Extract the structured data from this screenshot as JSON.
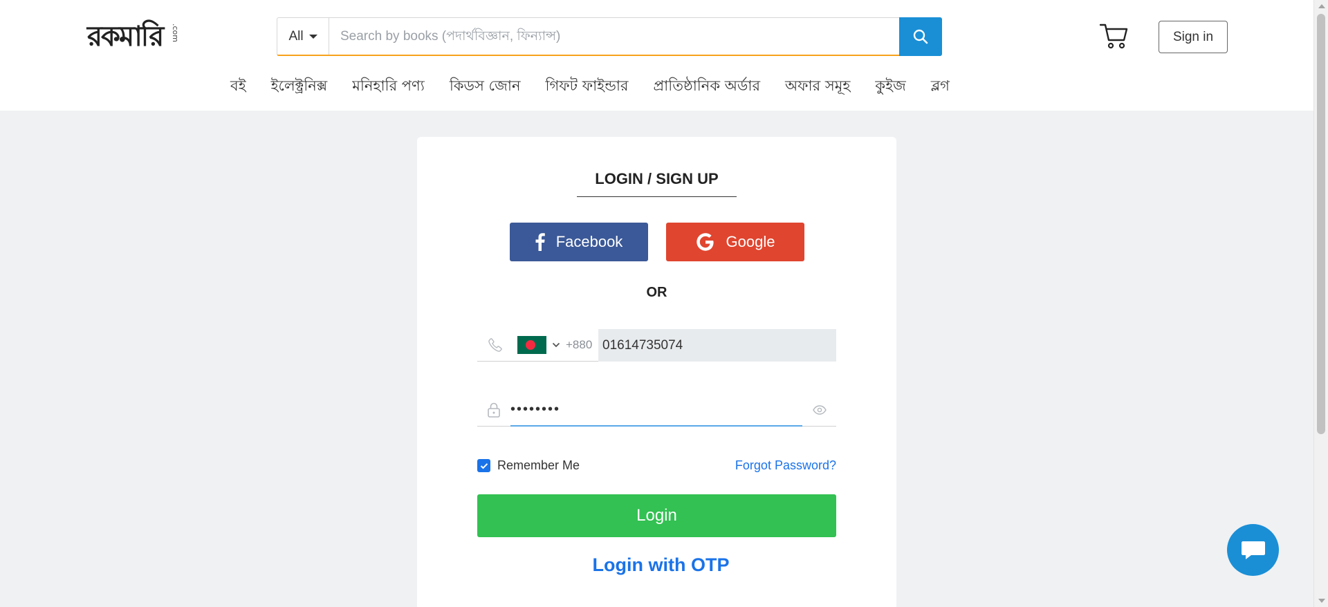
{
  "header": {
    "logo_text": "রকমারি",
    "logo_suffix": ".com",
    "search": {
      "category": "All",
      "placeholder": "Search by books (পদার্থবিজ্ঞান, ফিন্যান্স)"
    },
    "signin_label": "Sign in",
    "nav": [
      {
        "label": "বই"
      },
      {
        "label": "ইলেক্ট্রনিক্স"
      },
      {
        "label": "মনিহারি পণ্য"
      },
      {
        "label": "কিডস জোন"
      },
      {
        "label": "গিফট ফাইন্ডার"
      },
      {
        "label": "প্রাতিষ্ঠানিক অর্ডার"
      },
      {
        "label": "অফার সমূহ"
      },
      {
        "label": "কুইজ"
      },
      {
        "label": "ব্লগ"
      }
    ]
  },
  "login": {
    "title": "LOGIN / SIGN UP",
    "facebook_label": "Facebook",
    "google_label": "Google",
    "or_label": "OR",
    "dial_code": "+880",
    "phone_value": "01614735074",
    "password_mask": "••••••••",
    "remember_label": "Remember Me",
    "remember_checked": true,
    "forgot_label": "Forgot Password?",
    "login_label": "Login",
    "otp_label": "Login with OTP"
  },
  "colors": {
    "facebook": "#3b5998",
    "google": "#e0452f",
    "login": "#32c152",
    "link": "#1a73e8",
    "search_button": "#1a8fd6"
  }
}
